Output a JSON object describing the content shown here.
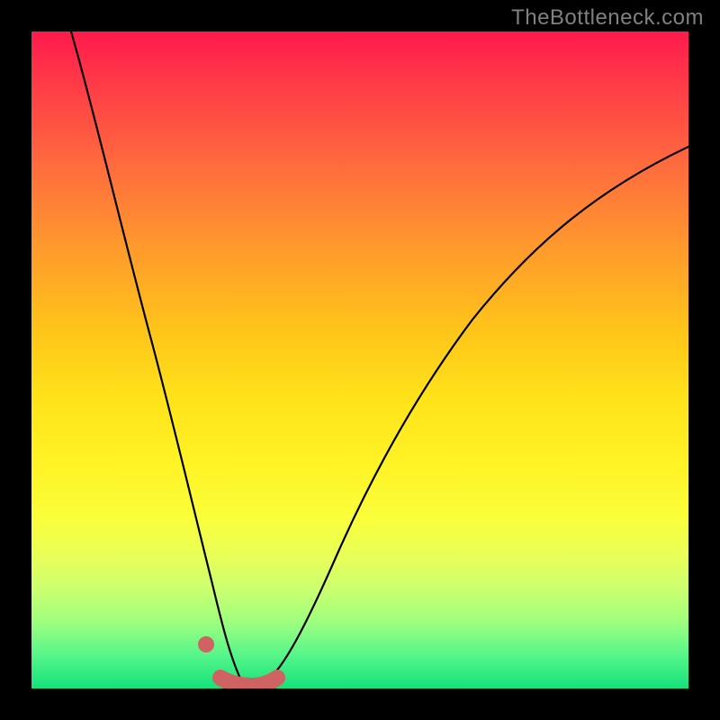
{
  "watermark": "TheBottleneck.com",
  "chart_data": {
    "type": "line",
    "title": "",
    "xlabel": "",
    "ylabel": "",
    "xlim": [
      0,
      100
    ],
    "ylim": [
      0,
      100
    ],
    "grid": false,
    "series": [
      {
        "name": "bottleneck-curve",
        "x": [
          6,
          10,
          14,
          18,
          22,
          25,
          27,
          29,
          30.5,
          32,
          33.5,
          35,
          37,
          40,
          44,
          50,
          56,
          62,
          70,
          80,
          90,
          100
        ],
        "y": [
          100,
          88,
          75,
          62,
          47,
          33,
          23,
          14,
          7.5,
          2.5,
          1,
          1.2,
          3,
          8,
          15,
          25,
          35,
          44,
          54,
          64,
          72,
          78
        ]
      }
    ],
    "optimal_range_x": [
      28.5,
      37.5
    ],
    "marker_point": {
      "x": 26.6,
      "y": 12
    },
    "gradient_stops": [
      {
        "pct": 0,
        "color": "#ff1a4d"
      },
      {
        "pct": 100,
        "color": "#14e27a"
      }
    ]
  }
}
